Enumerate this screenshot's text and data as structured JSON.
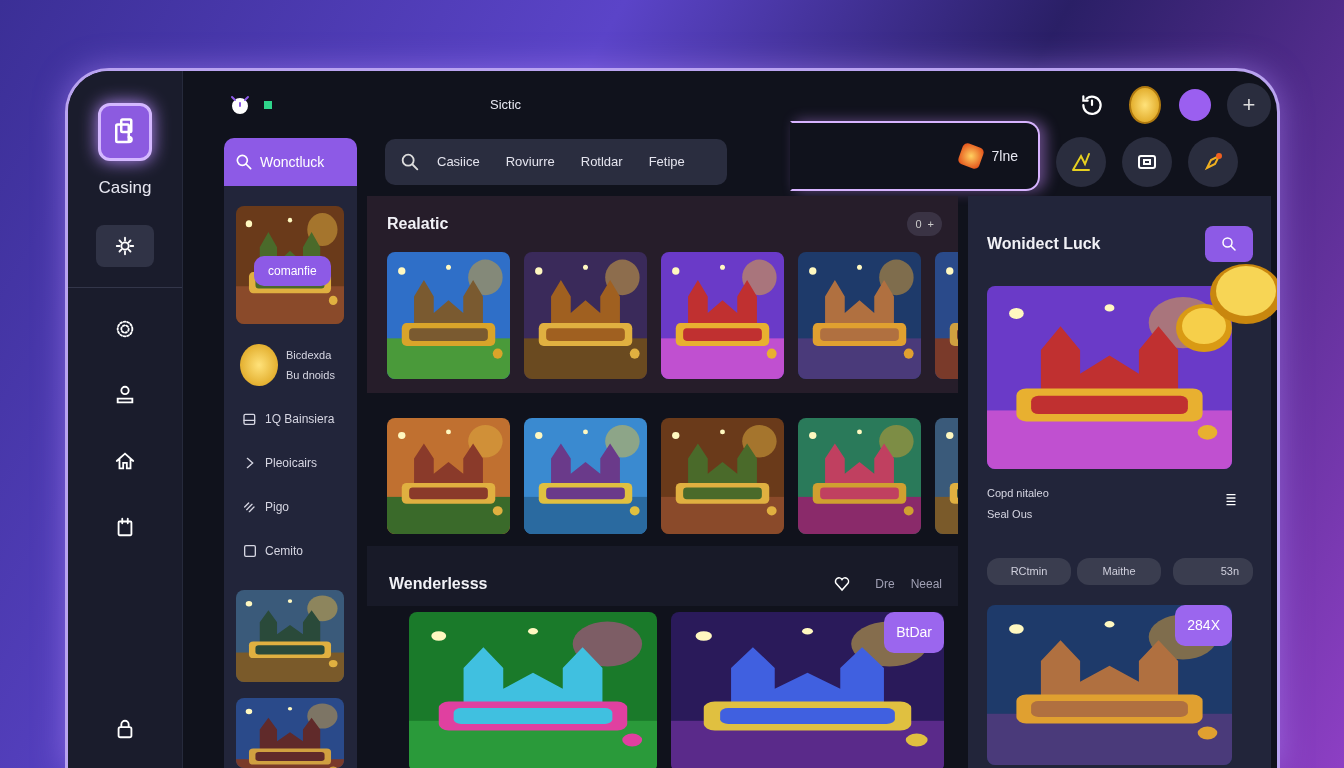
{
  "rail": {
    "logo_label": "Casing",
    "items": [
      {
        "selected": true
      },
      {
        "selected": false
      },
      {
        "selected": false
      },
      {
        "selected": false
      },
      {
        "selected": false
      }
    ]
  },
  "top_bar": {
    "title": "Sictic",
    "add_label": "+"
  },
  "left_panel": {
    "search_label": "Wonctluck",
    "featured_button": "comanfie",
    "coin_item": {
      "line_1": "Bicdexda",
      "line_2": "Bu dnoids"
    },
    "items": [
      {
        "label": "1Q Bainsiera"
      },
      {
        "label": "Pleoicairs"
      },
      {
        "label": "Pigo"
      },
      {
        "label": "Cemito"
      }
    ]
  },
  "filter_tabs": [
    {
      "label": "Casiice"
    },
    {
      "label": "Roviurre"
    },
    {
      "label": "Rotldar"
    },
    {
      "label": "Fetipe"
    }
  ],
  "balance": {
    "value": "7lne"
  },
  "sections": [
    {
      "title": "Realatic",
      "counter": "0",
      "add": "+"
    },
    {
      "title": "Wenderlesss",
      "links": [
        "Dre",
        "Neeal"
      ],
      "badge": "BtDar"
    }
  ],
  "right_panel": {
    "title": "Wonidect Luck",
    "caption_line_1": "Copd nitaleo",
    "caption_line_2": "Seal Ous",
    "chips": [
      "RCtmin",
      "Maithe",
      "53n"
    ],
    "badge": "284X"
  }
}
